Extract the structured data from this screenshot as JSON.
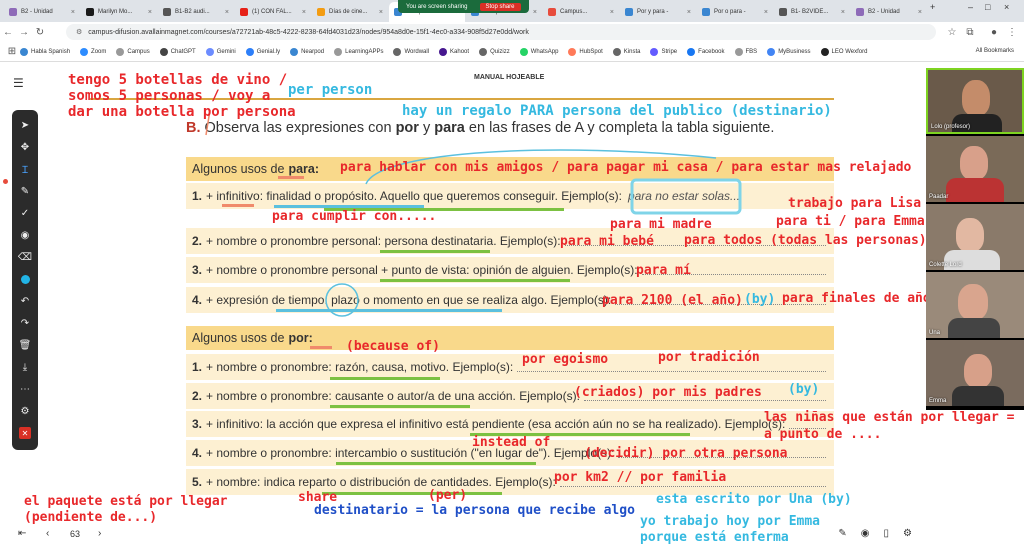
{
  "browser": {
    "tabs": [
      {
        "label": "B2 - Unidad",
        "color": "#8e6bb8"
      },
      {
        "label": "Marilyn Mo...",
        "color": "#1a1a1a"
      },
      {
        "label": "B1-B2 audi...",
        "color": "#555"
      },
      {
        "label": "(1) CON FAL...",
        "color": "#e62117"
      },
      {
        "label": "Días de cine...",
        "color": "#f39c12"
      },
      {
        "label": "Campus...",
        "color": "#3a86d1"
      },
      {
        "label": "Campus...",
        "color": "#3a86d1"
      },
      {
        "label": "Campus...",
        "color": "#e74c3c"
      },
      {
        "label": "Por y para -",
        "color": "#3a86d1"
      },
      {
        "label": "Por o para -",
        "color": "#3a86d1"
      },
      {
        "label": "B1- B2VIDE...",
        "color": "#555"
      },
      {
        "label": "B2 - Unidad",
        "color": "#8e6bb8"
      }
    ],
    "sharing_text": "You are screen sharing",
    "stop_share": "Stop share",
    "url": "campus-difusion.avallainmagnet.com/courses/a72721ab-48c5-4222-8238-64fd4031d23/nodes/954a8d0e-15f1-4ec0-a334-908f5d27e0dd/work",
    "bookmarks": [
      {
        "label": "Habla Spanish",
        "color": "#3a86d1"
      },
      {
        "label": "Zoom",
        "color": "#2d8cff"
      },
      {
        "label": "Campus",
        "color": "#999"
      },
      {
        "label": "ChatGPT",
        "color": "#444"
      },
      {
        "label": "Gemini",
        "color": "#6c8cff"
      },
      {
        "label": "Genial.ly",
        "color": "#2d7ff9"
      },
      {
        "label": "Nearpod",
        "color": "#3a86d1"
      },
      {
        "label": "LearningAPPs",
        "color": "#999"
      },
      {
        "label": "Wordwall",
        "color": "#666"
      },
      {
        "label": "Kahoot",
        "color": "#46178f"
      },
      {
        "label": "Quizizz",
        "color": "#666"
      },
      {
        "label": "WhatsApp",
        "color": "#25d366"
      },
      {
        "label": "HubSpot",
        "color": "#ff7a59"
      },
      {
        "label": "Kinsta",
        "color": "#666"
      },
      {
        "label": "Stripe",
        "color": "#635bff"
      },
      {
        "label": "Facebook",
        "color": "#1877f2"
      },
      {
        "label": "FBS",
        "color": "#999"
      },
      {
        "label": "MyBusiness",
        "color": "#4285f4"
      },
      {
        "label": "LEO Wexford",
        "color": "#222"
      }
    ],
    "all_bookmarks": "All Bookmarks"
  },
  "book": {
    "manual_title": "MANUAL HOJEABLE",
    "exercise": {
      "letter": "B.",
      "text_1": "Observa las expresiones con",
      "word_por": "por",
      "text_2": "y",
      "word_para": "para",
      "text_3": "en las frases de A y completa la tabla siguiente."
    },
    "para_header": "Algunos usos de",
    "para_word": "para:",
    "para_rows": [
      {
        "num": "1.",
        "text": "+ infinitivo: finalidad o propósito. Aquello que queremos conseguir. Ejemplo(s):",
        "example": "para no estar solas..."
      },
      {
        "num": "2.",
        "text": "+ nombre o pronombre personal: persona destinataria. Ejemplo(s):",
        "example": ""
      },
      {
        "num": "3.",
        "text": "+ nombre o pronombre personal + punto de vista: opinión de alguien. Ejemplo(s):",
        "example": ""
      },
      {
        "num": "4.",
        "text": "+ expresión de tiempo: plazo o momento en que se realiza algo. Ejemplo(s):",
        "example": ""
      }
    ],
    "por_header": "Algunos usos de",
    "por_word": "por:",
    "por_rows": [
      {
        "num": "1.",
        "text": "+ nombre o pronombre: razón, causa, motivo. Ejemplo(s):"
      },
      {
        "num": "2.",
        "text": "+ nombre o pronombre: causante o autor/a de una acción. Ejemplo(s):"
      },
      {
        "num": "3.",
        "text": "+ infinitivo: la acción que expresa el infinitivo está pendiente (esa acción aún no se ha realizado). Ejemplo(s):"
      },
      {
        "num": "4.",
        "text": "+ nombre o pronombre: intercambio o sustitución (\"en lugar de\"). Ejemplo(s):"
      },
      {
        "num": "5.",
        "text": "+ nombre: indica reparto o distribución de cantidades. Ejemplo(s):"
      }
    ]
  },
  "annotations": {
    "a1": "tengo 5 botellas de vino /",
    "a2": "somos 5 personas / voy a",
    "a3": "dar una botella por persona",
    "a4": "per person",
    "a5": "hay un regalo  PARA  persona del publico (destinario)",
    "a6": "para hablar con mis amigos / para pagar mi casa / para estar mas relajado",
    "a7": "para cumplir con.....",
    "a8": "trabajo para Lisa",
    "a9": "para ti / para Emma",
    "a10": "para mi madre",
    "a11": "para mi bebé",
    "a12": "para todos (todas las personas)",
    "a13": "para mí",
    "a14": "para 2100 (el año)",
    "a15": "(by)",
    "a16": "para finales de año",
    "a17": "(because of)",
    "a18": "por egoismo",
    "a19": "por tradición",
    "a20": "(criados) por mis padres",
    "a21": "(by)",
    "a22": "las niñas que están por llegar =",
    "a23": "a punto de ....",
    "a24": "instead of",
    "a25": "(decidir) por otra persona",
    "a26": "por km2 // por familia",
    "a27": "share",
    "a28": "(per)",
    "a29": "el paquete está por llegar",
    "a30": "(pendiente de...)",
    "a31": "destinatario = la persona que recibe algo",
    "a32": "esta escrito por Una (by)",
    "a33": "yo trabajo hoy por Emma",
    "a34": "porque está enferma"
  },
  "footer": {
    "page": "63"
  },
  "participants": [
    {
      "name": "Lolo (profesor)"
    },
    {
      "name": "Paadar"
    },
    {
      "name": "Colette Lord"
    },
    {
      "name": "Una"
    },
    {
      "name": "Emma"
    }
  ],
  "colors": {
    "red_annotation": "#e8282b",
    "cyan_annotation": "#35b9e0",
    "blue_annotation": "#1f4fc7",
    "section_header": "#f9d98b",
    "row_bg": "#fdf0d2"
  }
}
